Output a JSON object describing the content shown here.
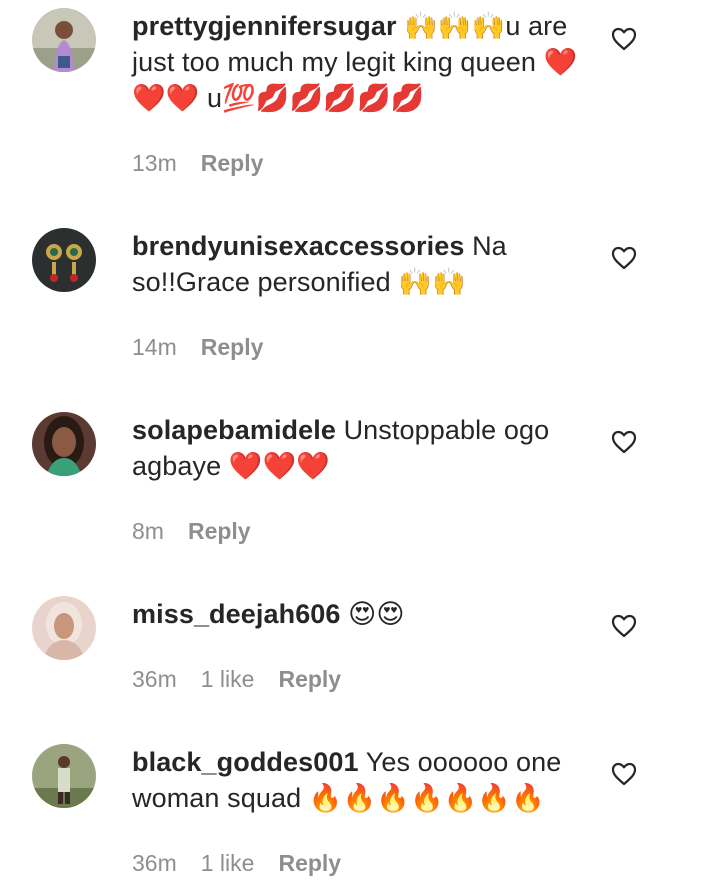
{
  "comments": [
    {
      "username": "prettygjennifersugar",
      "text": " 🙌🙌🙌u are just too much my legit king queen ❤️❤️❤️ u💯💋💋💋💋💋",
      "time": "13m",
      "likes": "",
      "reply": "Reply",
      "avatar_color": "#8a8f7c"
    },
    {
      "username": "brendyunisexaccessories",
      "text": " Na so!!Grace personified 🙌🙌",
      "time": "14m",
      "likes": "",
      "reply": "Reply",
      "avatar_color": "#2b2f2f"
    },
    {
      "username": "solapebamidele",
      "text": " Unstoppable ogo agbaye ❤️❤️❤️",
      "time": "8m",
      "likes": "",
      "reply": "Reply",
      "avatar_color": "#3a2a25"
    },
    {
      "username": "miss_deejah606",
      "text": " 😍😍",
      "time": "36m",
      "likes": "1 like",
      "reply": "Reply",
      "avatar_color": "#d9b7a8"
    },
    {
      "username": "black_goddes001",
      "text": " Yes oooooo one woman squad 🔥🔥🔥🔥🔥🔥🔥",
      "time": "36m",
      "likes": "1 like",
      "reply": "Reply",
      "avatar_color": "#7d8a6a"
    }
  ],
  "colors": {
    "text": "#262626",
    "meta": "#8e8e8e",
    "heart_outline": "#262626"
  },
  "icons": {
    "like": "heart-outline-icon"
  }
}
